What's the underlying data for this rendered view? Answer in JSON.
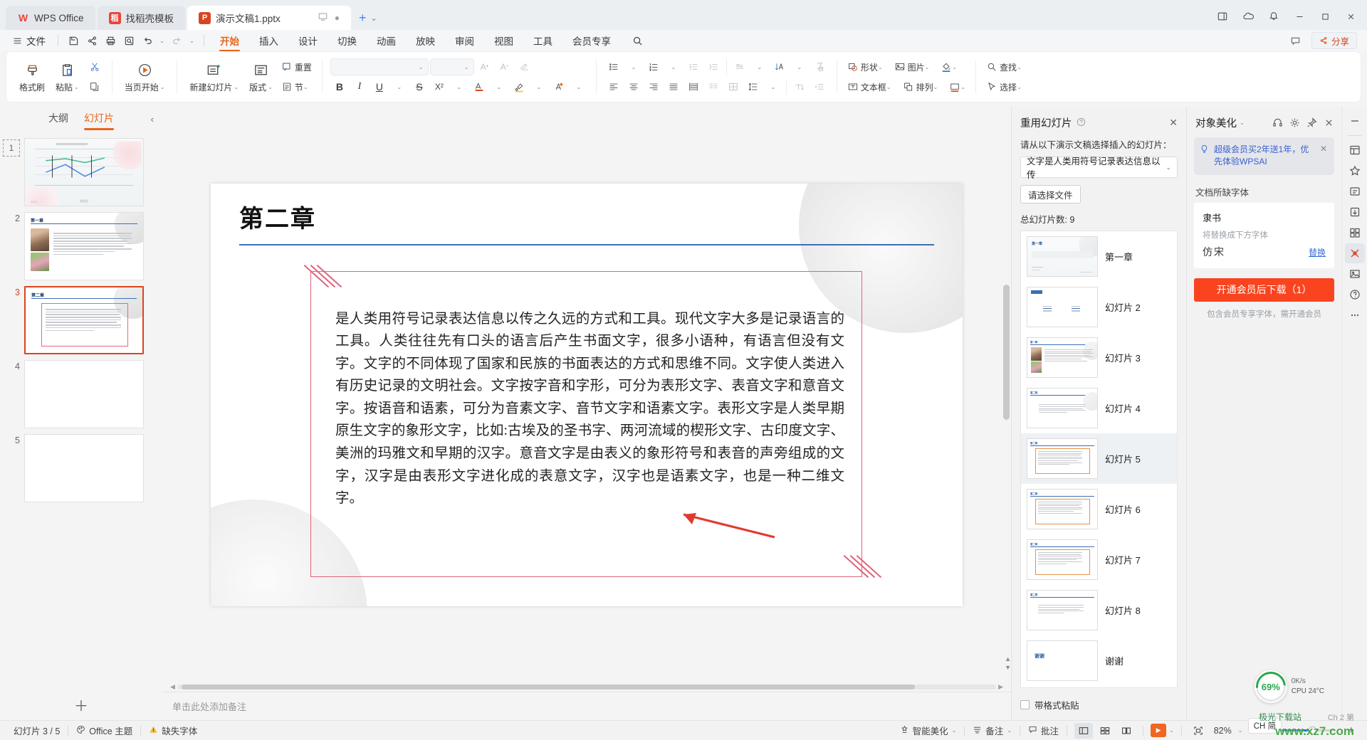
{
  "titlebar": {
    "tabs": [
      {
        "label": "WPS Office",
        "icon": "wps-logo-icon",
        "kind": "plain"
      },
      {
        "label": "找稻壳模板",
        "icon": "template-icon",
        "kind": "plain"
      },
      {
        "label": "演示文稿1.pptx",
        "icon": "powerpoint-icon",
        "kind": "active"
      }
    ],
    "add_label": "+",
    "add_caret": "⌄",
    "window_buttons": [
      "sidebar-toggle",
      "cloud-sync",
      "notification",
      "minimize",
      "maximize",
      "close"
    ]
  },
  "menubar": {
    "file_label": "文件",
    "quick_icons": [
      "save-icon",
      "share-icon",
      "print-icon",
      "print-preview-icon",
      "undo-icon",
      "redo-icon",
      "more-icon"
    ],
    "items": [
      {
        "label": "开始",
        "selected": true
      },
      {
        "label": "插入",
        "selected": false
      },
      {
        "label": "设计",
        "selected": false
      },
      {
        "label": "切换",
        "selected": false
      },
      {
        "label": "动画",
        "selected": false
      },
      {
        "label": "放映",
        "selected": false
      },
      {
        "label": "审阅",
        "selected": false
      },
      {
        "label": "视图",
        "selected": false
      },
      {
        "label": "工具",
        "selected": false
      },
      {
        "label": "会员专享",
        "selected": false
      }
    ],
    "search_icon": "search-icon",
    "comment_icon": "comment-icon",
    "share_label": "分享"
  },
  "ribbon": {
    "clipboard": {
      "format_painter": "格式刷",
      "paste": "粘贴",
      "copy_icon": "copy-icon",
      "cut_icon": "cut-icon"
    },
    "slideshow": {
      "from_current": "当页开始"
    },
    "slides": {
      "new_slide": "新建幻灯片",
      "layout": "版式",
      "section": "节",
      "reset": "重置"
    },
    "font": {
      "family_value": "",
      "size_value": "",
      "grow_icon": "increase-font-size-icon",
      "shrink_icon": "decrease-font-size-icon",
      "clear_format_icon": "clear-format-icon",
      "bold": "B",
      "italic": "I",
      "underline": "U",
      "strike": "S",
      "superscript": "X²",
      "font_color_icon": "font-color-icon",
      "highlight_icon": "highlight-icon",
      "text_effect_icon": "text-effect-icon"
    },
    "paragraph": {
      "bullets_icon": "bullet-list-icon",
      "numbering_icon": "numbered-list-icon",
      "decrease_indent_icon": "decrease-indent-icon",
      "increase_indent_icon": "increase-indent-icon",
      "align_left_icon": "align-left-icon",
      "align_center_icon": "align-center-icon",
      "align_right_icon": "align-right-icon",
      "justify_icon": "justify-icon",
      "distribute_icon": "distribute-icon",
      "line_spacing_icon": "line-spacing-icon",
      "columns_icon": "columns-icon",
      "text_direction_icon": "text-direction-icon",
      "smart_fill_icon": "smart-fill-icon",
      "pinyin_icon": "pinyin-guide-icon",
      "sort_icon": "sort-icon",
      "merge_icon": "merge-shape-icon"
    },
    "insert": {
      "shape": "形状",
      "picture": "图片",
      "textbox": "文本框",
      "arrange": "排列",
      "fill_icon": "fill-color-icon",
      "outline_icon": "shape-outline-icon"
    },
    "editing": {
      "find": "查找",
      "select": "选择"
    }
  },
  "thumbnails": {
    "tab_outline": "大纲",
    "tab_slides": "幻灯片",
    "collapse_icon": "chevron-left-icon",
    "add_slide_icon": "plus-icon",
    "items": [
      {
        "num": "1",
        "kind": "chart",
        "selected": false
      },
      {
        "num": "2",
        "kind": "photo-text",
        "selected": false
      },
      {
        "num": "3",
        "kind": "text-frame",
        "selected": true
      },
      {
        "num": "4",
        "kind": "blank",
        "selected": false
      },
      {
        "num": "5",
        "kind": "blank",
        "selected": false
      }
    ]
  },
  "slide": {
    "title": "第二章",
    "body": "是人类用符号记录表达信息以传之久远的方式和工具。现代文字大多是记录语言的工具。人类往往先有口头的语言后产生书面文字，很多小语种，有语言但没有文字。文字的不同体现了国家和民族的书面表达的方式和思维不同。文字使人类进入有历史记录的文明社会。文字按字音和字形，可分为表形文字、表音文字和意音文字。按语音和语素，可分为音素文字、音节文字和语素文字。表形文字是人类早期原生文字的象形文字，比如:古埃及的圣书字、两河流域的楔形文字、古印度文字、美洲的玛雅文和早期的汉字。意音文字是由表义的象形符号和表音的声旁组成的文字，汉字是由表形文字进化成的表意文字，汉字也是语素文字，也是一种二维文字。"
  },
  "notes": {
    "placeholder": "单击此处添加备注"
  },
  "reuse_panel": {
    "title": "重用幻灯片",
    "help_icon": "question-circle-icon",
    "close_icon": "close-icon",
    "subtitle": "请从以下演示文稿选择插入的幻灯片：",
    "select_value": "文字是人类用符号记录表达信息以传",
    "choose_file_label": "请选择文件",
    "total_label": "总幻灯片数: 9",
    "slides": [
      {
        "name": "第一章",
        "kind": "title",
        "selected": false
      },
      {
        "name": "幻灯片 2",
        "kind": "two-col",
        "selected": false
      },
      {
        "name": "幻灯片 3",
        "kind": "photo-text",
        "selected": false
      },
      {
        "name": "幻灯片 4",
        "kind": "text",
        "selected": false
      },
      {
        "name": "幻灯片 5",
        "kind": "text-frame",
        "selected": true
      },
      {
        "name": "幻灯片 6",
        "kind": "text-frame",
        "selected": false
      },
      {
        "name": "幻灯片 7",
        "kind": "text-frame",
        "selected": false
      },
      {
        "name": "幻灯片 8",
        "kind": "text",
        "selected": false
      },
      {
        "name": "谢谢",
        "kind": "thanks",
        "thumb_text": "谢谢",
        "selected": false
      }
    ],
    "keep_format_label": "带格式粘贴"
  },
  "beautify_panel": {
    "title": "对象美化",
    "caret": "⌄",
    "icons": [
      "headset-icon",
      "gear-icon",
      "pin-icon",
      "close-icon"
    ],
    "promo_text": "超级会员买2年送1年，优先体验WPSAI",
    "promo_close_icon": "close-icon",
    "section_title": "文档所缺字体",
    "missing_font": "隶书",
    "replace_hint": "将替换成下方字体",
    "replacement_font": "仿宋",
    "replace_link": "替换",
    "download_button": "开通会员后下载（1）",
    "download_note": "包含会员专享字体，需开通会员"
  },
  "right_rail": {
    "items": [
      "minimize-panel-icon",
      "template-rail-icon",
      "favorite-rail-icon",
      "resource-rail-icon",
      "export-rail-icon",
      "design-rail-icon",
      "tools-rail-icon",
      "help-rail-icon",
      "more-rail-icon"
    ]
  },
  "status_bar": {
    "slide_counter": "幻灯片 3 / 5",
    "theme_icon": "theme-icon",
    "theme_label": "Office 主题",
    "warn_icon": "warning-icon",
    "warn_label": "缺失字体",
    "beautify_icon": "smart-beautify-icon",
    "beautify_label": "智能美化",
    "notes_icon": "notes-icon",
    "notes_label": "备注",
    "comment_icon": "comment-icon",
    "comment_label": "批注",
    "view_normal_icon": "view-normal-icon",
    "view_sorter_icon": "view-sorter-icon",
    "view_reading_icon": "view-reading-icon",
    "play_icon": "play-icon",
    "fit_icon": "fit-slide-icon",
    "zoom_value": "82%",
    "zoom_caret": "⌄",
    "zoom_out": "−",
    "zoom_in": "+",
    "ime_label": "CH 简"
  },
  "floating": {
    "cpu_percent": "69%",
    "net_speed": "0K/s",
    "cpu_temp": "CPU 24°C",
    "watermark": "www.xz7.com",
    "watermark_brand": "极光下载站",
    "chapter_note": "Ch 2 第"
  },
  "colors": {
    "accent": "#e8661a",
    "brand_red": "#d9451f",
    "slide_rule": "#3b6fb5",
    "frame_pink": "#e0637d",
    "arrow_red": "#e03a2f",
    "cta_red": "#f9441f",
    "link_blue": "#3a6fd8"
  }
}
